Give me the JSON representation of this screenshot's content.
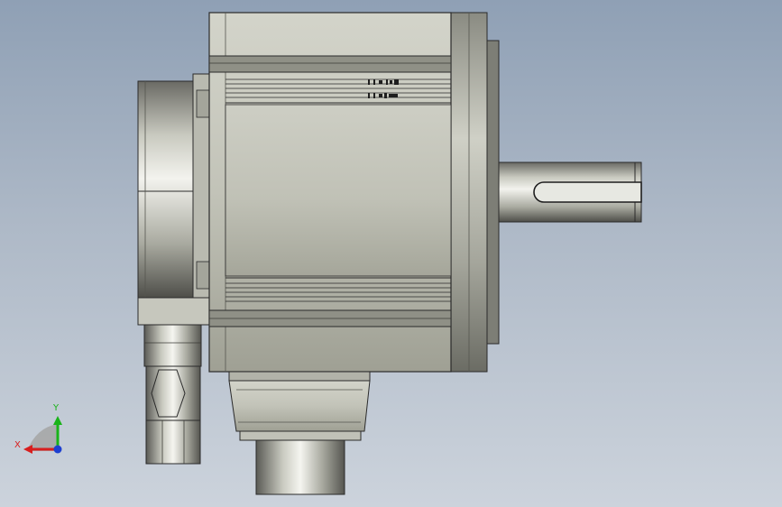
{
  "triad": {
    "x_label": "X",
    "y_label": "Y"
  },
  "colors": {
    "background_top": "#8fa0b5",
    "background_bottom": "#ccd3dc",
    "housing": "#c4c5ba",
    "edge": "#2a2a2a",
    "axis_x": "#d81e1e",
    "axis_y": "#19b319",
    "axis_z": "#1d3fd0"
  }
}
